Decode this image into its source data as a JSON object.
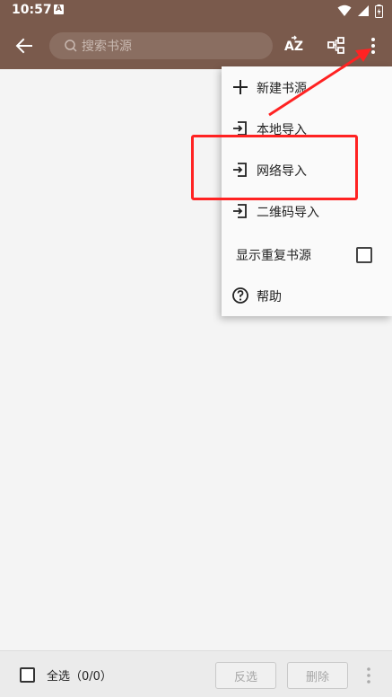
{
  "status_bar": {
    "time": "10:57",
    "notification_icon": "A"
  },
  "toolbar": {
    "search_placeholder": "搜索书源",
    "sort_icon_label": "AZ"
  },
  "menu": {
    "items": [
      {
        "label": "新建书源",
        "icon": "plus-icon"
      },
      {
        "label": "本地导入",
        "icon": "import-icon"
      },
      {
        "label": "网络导入",
        "icon": "import-icon"
      },
      {
        "label": "二维码导入",
        "icon": "import-icon"
      },
      {
        "label": "显示重复书源",
        "icon": "checkbox"
      },
      {
        "label": "帮助",
        "icon": "help-icon"
      }
    ]
  },
  "bottom_bar": {
    "select_all_label": "全选（0/0）",
    "invert_label": "反选",
    "delete_label": "删除"
  },
  "colors": {
    "toolbar": "#7a5a4c",
    "annotation": "#ff2222"
  }
}
